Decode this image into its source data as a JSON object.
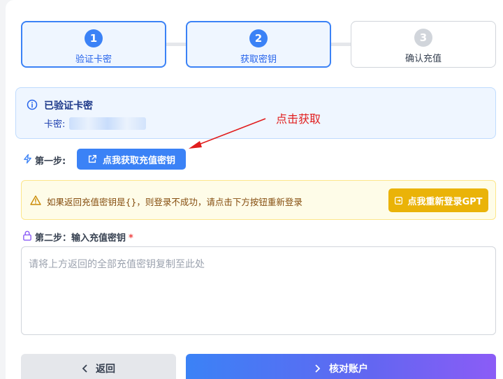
{
  "steps": [
    {
      "number": "1",
      "label": "验证卡密",
      "state": "active"
    },
    {
      "number": "2",
      "label": "获取密钥",
      "state": "active"
    },
    {
      "number": "3",
      "label": "确认充值",
      "state": "inactive"
    }
  ],
  "verified": {
    "title": "已验证卡密",
    "key_label": "卡密:"
  },
  "annotation": {
    "text": "点击获取",
    "color": "#e11d1d"
  },
  "step1": {
    "label": "第一步:",
    "button_label": "点我获取充值密钥"
  },
  "warning": {
    "text": "如果返回充值密钥是{}，则登录不成功，请点击下方按钮重新登录",
    "button_label": "点我重新登录GPT"
  },
  "step2": {
    "label": "第二步：输入充值密钥",
    "required_mark": "*",
    "placeholder": "请将上方返回的全部充值密钥复制至此处",
    "value": ""
  },
  "footer": {
    "back_label": "返回",
    "verify_label": "核对账户"
  },
  "colors": {
    "primary": "#3b82f6",
    "warning": "#eab308",
    "gradient_end": "#8b5cf6"
  },
  "icons": {
    "verified": "info-icon",
    "step1": "lightning-icon",
    "step1_button": "external-link-icon",
    "warning": "warning-triangle-icon",
    "warning_button": "login-icon",
    "step2": "lock-icon",
    "back": "chevron-left-icon",
    "verify": "chevron-right-icon"
  }
}
